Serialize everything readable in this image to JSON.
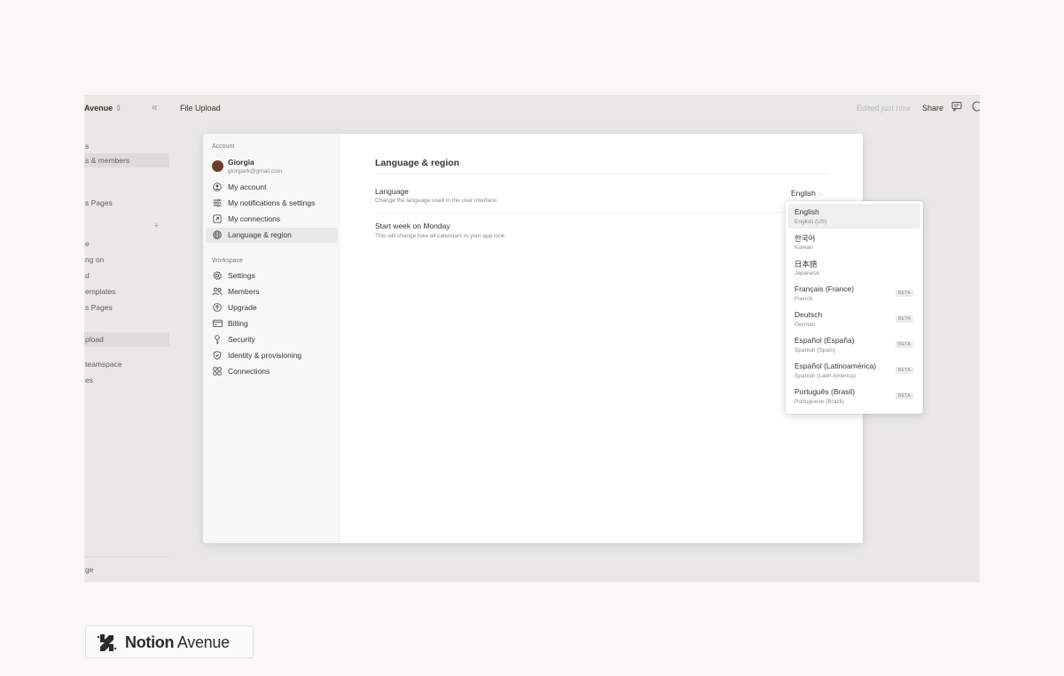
{
  "topbar": {
    "workspace": "Avenue",
    "workspace_chevron": "⇕",
    "collapse": "«",
    "breadcrumb": "File Upload",
    "edited": "Edited just now",
    "share": "Share",
    "comment_icon": "comment-icon",
    "clock_icon": "clock-icon"
  },
  "bg_sidebar": {
    "items": [
      "s",
      "s & members",
      "s Pages",
      "e",
      "ng on",
      "d",
      "emplates",
      "s Pages",
      "pload",
      "teamspace",
      "es",
      "ge"
    ]
  },
  "modal": {
    "account_label": "Account",
    "user": {
      "name": "Giorgia",
      "email": "giorgiark@gmail.com"
    },
    "account_items": [
      {
        "label": "My account",
        "icon": "user-circle-icon"
      },
      {
        "label": "My notifications & settings",
        "icon": "sliders-icon"
      },
      {
        "label": "My connections",
        "icon": "external-link-icon"
      },
      {
        "label": "Language & region",
        "icon": "globe-icon"
      }
    ],
    "workspace_label": "Workspace",
    "workspace_items": [
      {
        "label": "Settings",
        "icon": "gear-icon"
      },
      {
        "label": "Members",
        "icon": "users-icon"
      },
      {
        "label": "Upgrade",
        "icon": "upgrade-icon"
      },
      {
        "label": "Billing",
        "icon": "credit-card-icon"
      },
      {
        "label": "Security",
        "icon": "key-icon"
      },
      {
        "label": "Identity & provisioning",
        "icon": "shield-icon"
      },
      {
        "label": "Connections",
        "icon": "grid-icon"
      }
    ],
    "content": {
      "title": "Language & region",
      "language_label": "Language",
      "language_desc": "Change the language used in the user interface.",
      "language_value": "English",
      "week_label": "Start week on Monday",
      "week_desc": "This will change how all calendars in your app look."
    }
  },
  "dropdown": {
    "options": [
      {
        "name": "English",
        "sub": "English (US)",
        "beta": ""
      },
      {
        "name": "한국어",
        "sub": "Korean",
        "beta": ""
      },
      {
        "name": "日本語",
        "sub": "Japanese",
        "beta": ""
      },
      {
        "name": "Français (France)",
        "sub": "French",
        "beta": "BETA"
      },
      {
        "name": "Deutsch",
        "sub": "German",
        "beta": "BETA"
      },
      {
        "name": "Español (España)",
        "sub": "Spanish (Spain)",
        "beta": "BETA"
      },
      {
        "name": "Español (Latinoamérica)",
        "sub": "Spanish (Latin America)",
        "beta": "BETA"
      },
      {
        "name": "Português (Brasil)",
        "sub": "Portuguese (Brazil)",
        "beta": "BETA"
      }
    ]
  },
  "logo": {
    "bold": "Notion",
    "regular": " Avenue"
  }
}
